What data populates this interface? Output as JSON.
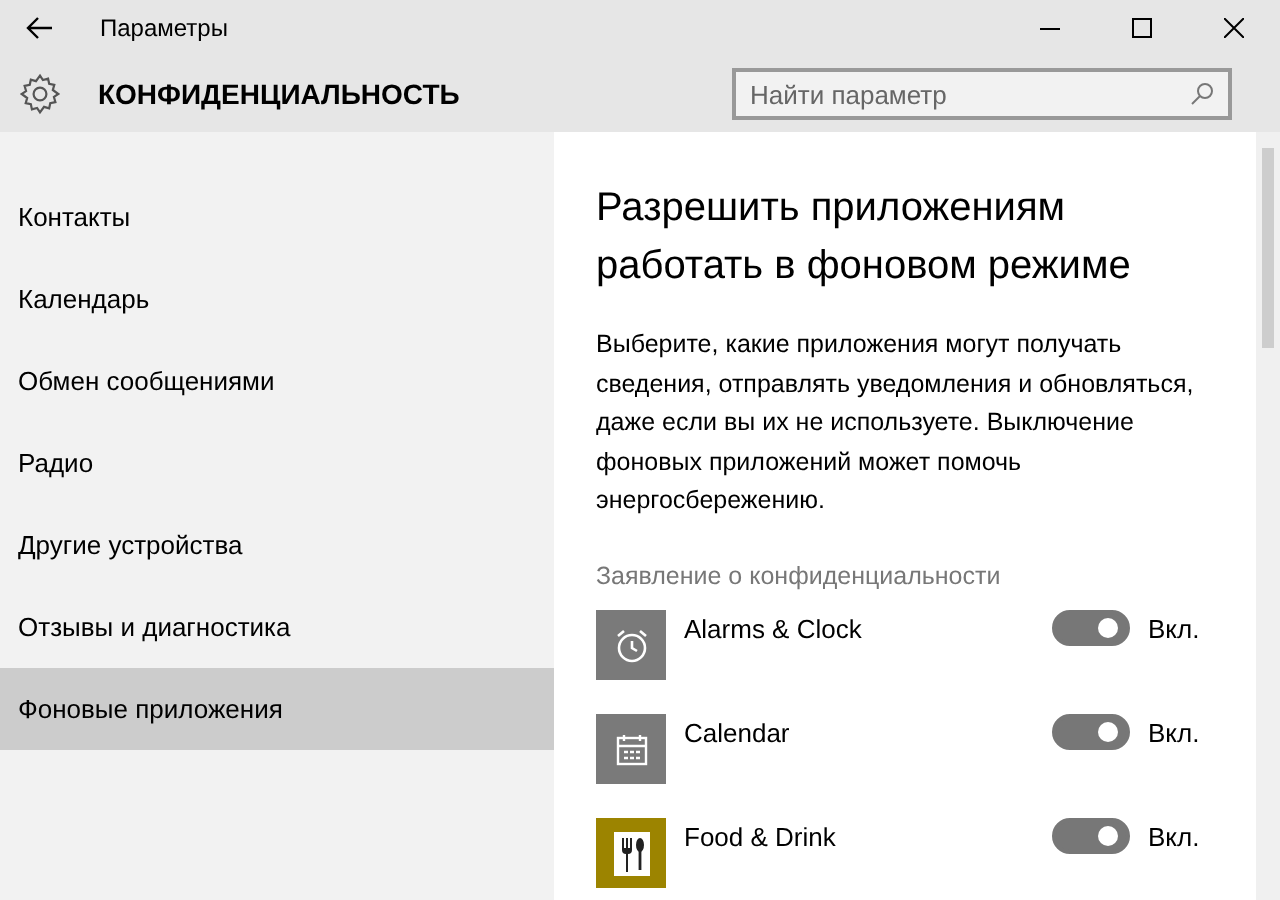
{
  "window": {
    "title": "Параметры"
  },
  "header": {
    "title": "КОНФИДЕНЦИАЛЬНОСТЬ",
    "search": {
      "placeholder": "Найти параметр"
    }
  },
  "sidebar": {
    "items": [
      {
        "label": "Контакты",
        "selected": false
      },
      {
        "label": "Календарь",
        "selected": false
      },
      {
        "label": "Обмен сообщениями",
        "selected": false
      },
      {
        "label": "Радио",
        "selected": false
      },
      {
        "label": "Другие устройства",
        "selected": false
      },
      {
        "label": "Отзывы и диагностика",
        "selected": false
      },
      {
        "label": "Фоновые приложения",
        "selected": true
      }
    ]
  },
  "content": {
    "heading": "Разрешить приложениям работать в фоновом режиме",
    "description": "Выберите, какие приложения могут получать сведения, отправлять уведомления и обновляться, даже если вы их не используете. Выключение фоновых приложений может помочь энергосбережению.",
    "privacy_link": "Заявление о конфиденциальности",
    "apps": [
      {
        "name": "Alarms & Clock",
        "kind": "clock",
        "color": "#7a7a7a",
        "on": true,
        "state": "Вкл."
      },
      {
        "name": "Calendar",
        "kind": "calendar",
        "color": "#7a7a7a",
        "on": true,
        "state": "Вкл."
      },
      {
        "name": "Food & Drink",
        "kind": "food",
        "color": "#9c8400",
        "on": true,
        "state": "Вкл."
      }
    ]
  }
}
